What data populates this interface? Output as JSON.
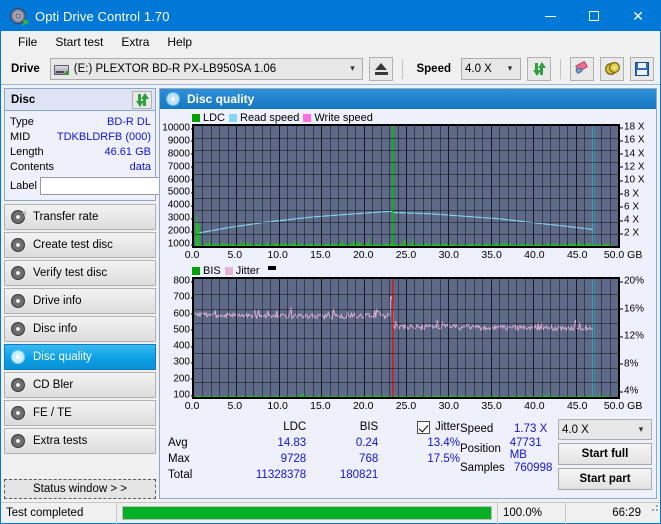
{
  "window": {
    "title": "Opti Drive Control 1.70",
    "icon": "optical-disc-icon",
    "minimize": "—",
    "maximize": "□",
    "close": "✕"
  },
  "menu": [
    "File",
    "Start test",
    "Extra",
    "Help"
  ],
  "drivebar": {
    "drive_label": "Drive",
    "drive_value": "(E:)   PLEXTOR BD-R  PX-LB950SA 1.06",
    "speed_label": "Speed",
    "speed_value": "4.0 X",
    "buttons": [
      "eject-button",
      "refresh-button",
      "erase-button",
      "disc-button",
      "save-button"
    ]
  },
  "disc_panel": {
    "title": "Disc",
    "refresh_icon": "refresh-icon",
    "rows": [
      {
        "key": "Type",
        "value": "BD-R DL"
      },
      {
        "key": "MID",
        "value": "TDKBLDRFB (000)"
      },
      {
        "key": "Length",
        "value": "46.61 GB"
      },
      {
        "key": "Contents",
        "value": "data"
      }
    ],
    "label_key": "Label",
    "label_value": "",
    "label_placeholder": ""
  },
  "sidebar": {
    "items": [
      {
        "label": "Transfer rate",
        "active": false
      },
      {
        "label": "Create test disc",
        "active": false
      },
      {
        "label": "Verify test disc",
        "active": false
      },
      {
        "label": "Drive info",
        "active": false
      },
      {
        "label": "Disc info",
        "active": false
      },
      {
        "label": "Disc quality",
        "active": true
      },
      {
        "label": "CD Bler",
        "active": false
      },
      {
        "label": "FE / TE",
        "active": false
      },
      {
        "label": "Extra tests",
        "active": false
      }
    ],
    "status_window_button": "Status window > >"
  },
  "main": {
    "title": "Disc quality",
    "icon": "disc-quality-icon"
  },
  "chart_data": [
    {
      "id": "top-chart",
      "type": "line",
      "title": "LDC / Read speed",
      "legend": [
        {
          "label": "LDC",
          "color": "#00a000"
        },
        {
          "label": "Read speed",
          "color": "#86d7f4"
        },
        {
          "label": "Write speed",
          "color": "#ff6ee0"
        }
      ],
      "legend_position": "top-left",
      "grid": true,
      "xlabel": "GB",
      "xlim": [
        0,
        50
      ],
      "xticks": [
        "0.0",
        "5.0",
        "10.0",
        "15.0",
        "20.0",
        "25.0",
        "30.0",
        "35.0",
        "40.0",
        "45.0",
        "50.0 GB"
      ],
      "ylabel_left": "LDC",
      "ylim_left": [
        0,
        10000
      ],
      "yticks_left": [
        "10000",
        "9000",
        "8000",
        "7000",
        "6000",
        "5000",
        "4000",
        "3000",
        "2000",
        "1000"
      ],
      "ylabel_right": "Speed",
      "ylim_right": [
        0,
        19
      ],
      "yticks_right": [
        "18 X",
        "16 X",
        "14 X",
        "12 X",
        "10 X",
        "8 X",
        "6 X",
        "4 X",
        "2 X"
      ],
      "series": [
        {
          "name": "Read speed",
          "color": "#86d7f4",
          "axis": "right",
          "x": [
            0.3,
            2,
            4,
            6,
            8,
            10,
            12,
            14,
            16,
            18,
            20,
            22,
            23.4,
            23.6,
            26,
            28,
            30,
            32,
            34,
            36,
            38,
            40,
            42,
            44,
            46,
            47.1
          ],
          "values": [
            2.0,
            2.4,
            2.9,
            3.3,
            3.7,
            4.0,
            4.3,
            4.6,
            4.8,
            5.0,
            5.2,
            5.4,
            5.5,
            5.3,
            5.2,
            5.1,
            4.9,
            4.7,
            4.5,
            4.3,
            4.0,
            3.7,
            3.4,
            3.1,
            2.8,
            2.6
          ]
        },
        {
          "name": "LDC",
          "color": "#00c000",
          "axis": "left",
          "note": "dense low-level error bars along bottom with large spike at layer break",
          "baseline": 120,
          "spikes": [
            {
              "x": 23.45,
              "value": 9728
            }
          ]
        }
      ],
      "markers": [
        {
          "name": "layer-break-marker",
          "x": 23.45,
          "color": "#00c000"
        },
        {
          "name": "end-of-data-marker",
          "x": 47.1,
          "color": "#3fd2ef"
        }
      ]
    },
    {
      "id": "bottom-chart",
      "type": "line",
      "title": "BIS / Jitter",
      "legend": [
        {
          "label": "BIS",
          "color": "#00a000"
        },
        {
          "label": "Jitter",
          "color": "#e7b4d8"
        }
      ],
      "legend_position": "top-left",
      "grid": true,
      "xlabel": "GB",
      "xlim": [
        0,
        50
      ],
      "xticks": [
        "0.0",
        "5.0",
        "10.0",
        "15.0",
        "20.0",
        "25.0",
        "30.0",
        "35.0",
        "40.0",
        "45.0",
        "50.0 GB"
      ],
      "ylabel_left": "BIS",
      "ylim_left": [
        0,
        800
      ],
      "yticks_left": [
        "800",
        "700",
        "600",
        "500",
        "400",
        "300",
        "200",
        "100"
      ],
      "ylabel_right": "Jitter",
      "ylim_right": [
        0,
        20
      ],
      "yticks_right": [
        "20%",
        "16%",
        "12%",
        "8%",
        "4%"
      ],
      "series": [
        {
          "name": "Jitter",
          "color": "#e7b4d8",
          "axis": "right",
          "note": "noisy trace ~13.8% for 0-23.4 GB then drops to ~11.8% for 23.5-47 GB",
          "segment_means": [
            {
              "from": 0.0,
              "to": 23.4,
              "percent": 13.9
            },
            {
              "from": 23.5,
              "to": 47.1,
              "percent": 11.9
            }
          ],
          "peak_percent": 17.5
        },
        {
          "name": "BIS",
          "color": "#00c000",
          "axis": "left",
          "note": "low-level green bars along bottom axis",
          "baseline": 6
        }
      ],
      "markers": [
        {
          "name": "layer-break-marker",
          "x": 23.45,
          "color": "#d02020"
        },
        {
          "name": "end-of-data-marker",
          "x": 47.1,
          "color": "#3fd2ef"
        }
      ]
    }
  ],
  "stats": {
    "headers": [
      "",
      "LDC",
      "BIS",
      "Jitter"
    ],
    "jitter_checkbox_checked": true,
    "rows": [
      {
        "label": "Avg",
        "ldc": "14.83",
        "bis": "0.24",
        "jitter": "13.4%"
      },
      {
        "label": "Max",
        "ldc": "9728",
        "bis": "768",
        "jitter": "17.5%"
      },
      {
        "label": "Total",
        "ldc": "11328378",
        "bis": "180821",
        "jitter": ""
      }
    ],
    "speed_key": "Speed",
    "speed_value": "1.73 X",
    "position_key": "Position",
    "position_value": "47731 MB",
    "samples_key": "Samples",
    "samples_value": "760998",
    "speed_select": "4.0 X",
    "start_full": "Start full",
    "start_part": "Start part"
  },
  "statusbar": {
    "message": "Test completed",
    "progress_percent": "100.0%",
    "progress_value": 100,
    "elapsed": "66:29"
  }
}
